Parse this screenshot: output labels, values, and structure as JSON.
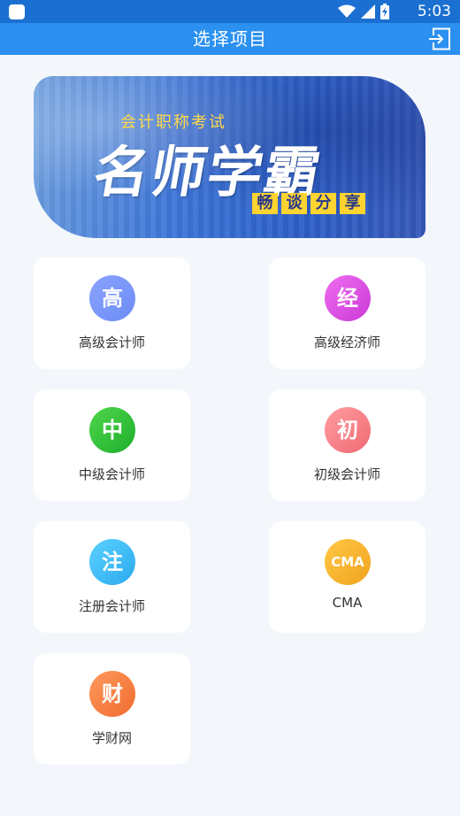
{
  "status_bar": {
    "time": "5:03"
  },
  "app_bar": {
    "title": "选择项目"
  },
  "banner": {
    "subtitle": "会计职称考试",
    "headline": "名师学霸",
    "tags": [
      "畅",
      "谈",
      "分",
      "享"
    ]
  },
  "projects": [
    {
      "label": "高级会计师",
      "icon_char": "高",
      "icon_name": "gao-icon",
      "color_from": "#8aa3ff",
      "color_to": "#6c8cf5"
    },
    {
      "label": "高级经济师",
      "icon_char": "经",
      "icon_name": "jing-icon",
      "color_from": "#f06cf0",
      "color_to": "#c93bd6"
    },
    {
      "label": "中级会计师",
      "icon_char": "中",
      "icon_name": "zhong-icon",
      "color_from": "#4fd64a",
      "color_to": "#1fae2d"
    },
    {
      "label": "初级会计师",
      "icon_char": "初",
      "icon_name": "chu-icon",
      "color_from": "#ff9ca0",
      "color_to": "#f06a73"
    },
    {
      "label": "注册会计师",
      "icon_char": "注",
      "icon_name": "zhu-icon",
      "color_from": "#5ad1ff",
      "color_to": "#2ba9ee"
    },
    {
      "label": "CMA",
      "icon_char": "CMA",
      "icon_name": "cma-icon",
      "color_from": "#ffc845",
      "color_to": "#f0a31f"
    },
    {
      "label": "学财网",
      "icon_char": "财",
      "icon_name": "cai-icon",
      "color_from": "#ff9a5c",
      "color_to": "#f06b2f"
    }
  ]
}
